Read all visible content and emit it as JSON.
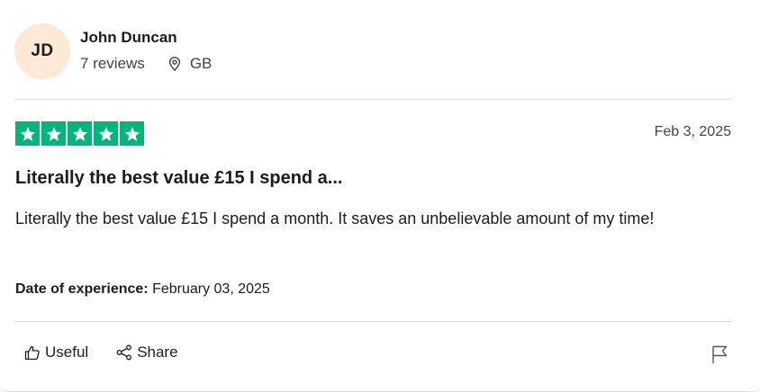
{
  "reviewer": {
    "initials": "JD",
    "name": "John Duncan",
    "review_count": "7 reviews",
    "location": "GB",
    "avatar_color": "#fde9d6"
  },
  "review": {
    "rating": 5,
    "star_color": "#00b67a",
    "date": "Feb 3, 2025",
    "title": "Literally the best value £15 I spend a...",
    "body": "Literally the best value £15 I spend a month. It saves an unbelievable amount of my time!",
    "experience_label": "Date of experience:",
    "experience_date": "February 03, 2025"
  },
  "actions": {
    "useful_label": "Useful",
    "share_label": "Share",
    "icons": [
      "thumbs-up-icon",
      "share-icon",
      "flag-icon"
    ]
  }
}
